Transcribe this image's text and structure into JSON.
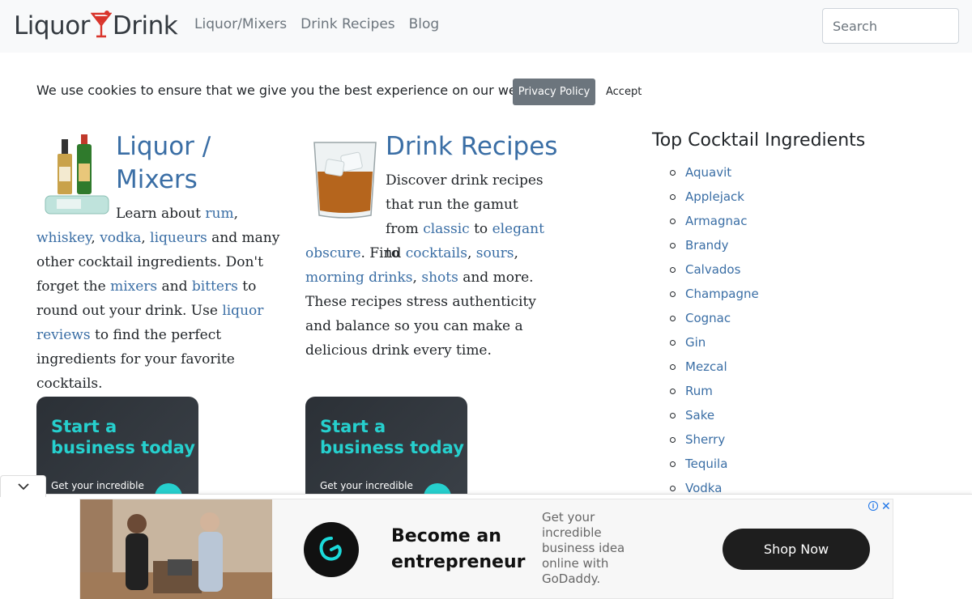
{
  "nav": {
    "brand_left": "Liquor",
    "brand_right": "Drink",
    "links": [
      "Liquor/Mixers",
      "Drink Recipes",
      "Blog"
    ],
    "search_placeholder": "Search"
  },
  "cookie": {
    "text": "We use cookies to ensure that we give you the best experience on our website.",
    "privacy_label": "Privacy Policy",
    "accept_label": "Accept"
  },
  "col1": {
    "title": "Liquor / Mixers",
    "t1": "Learn about ",
    "l_rum": "rum",
    "t2": ", ",
    "l_whiskey": "whiskey",
    "t3": ", ",
    "l_vodka": "vodka",
    "t4": ", ",
    "l_liqueurs": "liqueurs",
    "t5": " and many other cocktail ingredients. Don't forget the ",
    "l_mixers": "mixers",
    "t6": " and ",
    "l_bitters": "bitters",
    "t7": " to round out your drink. Use ",
    "l_reviews": "liquor reviews",
    "t8": " to find the perfect ingredients for your favorite cocktails."
  },
  "col2": {
    "title": "Drink Recipes",
    "a1": "Discover drink recipes that run the gamut from ",
    "l_classic": "classic",
    "a2": " to ",
    "l_elegant": "elegant",
    "a3": " to",
    "l_obscure": "obscure",
    "b1": ". Find ",
    "l_cocktails": "cocktails",
    "b2": ", ",
    "l_sours": "sours",
    "b3": ",",
    "l_morning": "morning drinks",
    "b4": ", ",
    "l_shots": "shots",
    "b5": " and more. These recipes stress authenticity and balance so you can make a delicious drink every time."
  },
  "ad_card": {
    "headline": "Start a business today",
    "sub": "Get your incredible"
  },
  "sidebar": {
    "title": "Top Cocktail Ingredients",
    "items": [
      "Aquavit",
      "Applejack",
      "Armagnac",
      "Brandy",
      "Calvados",
      "Champagne",
      "Cognac",
      "Gin",
      "Mezcal",
      "Rum",
      "Sake",
      "Sherry",
      "Tequila",
      "Vodka"
    ]
  },
  "banner": {
    "headline": "Become an entrepreneur",
    "copy": "Get your incredible business idea online with GoDaddy.",
    "button": "Shop Now",
    "close": "✕"
  },
  "colors": {
    "link": "#3a6ea5",
    "accent": "#26d0ce",
    "brand_red": "#d9342b"
  }
}
